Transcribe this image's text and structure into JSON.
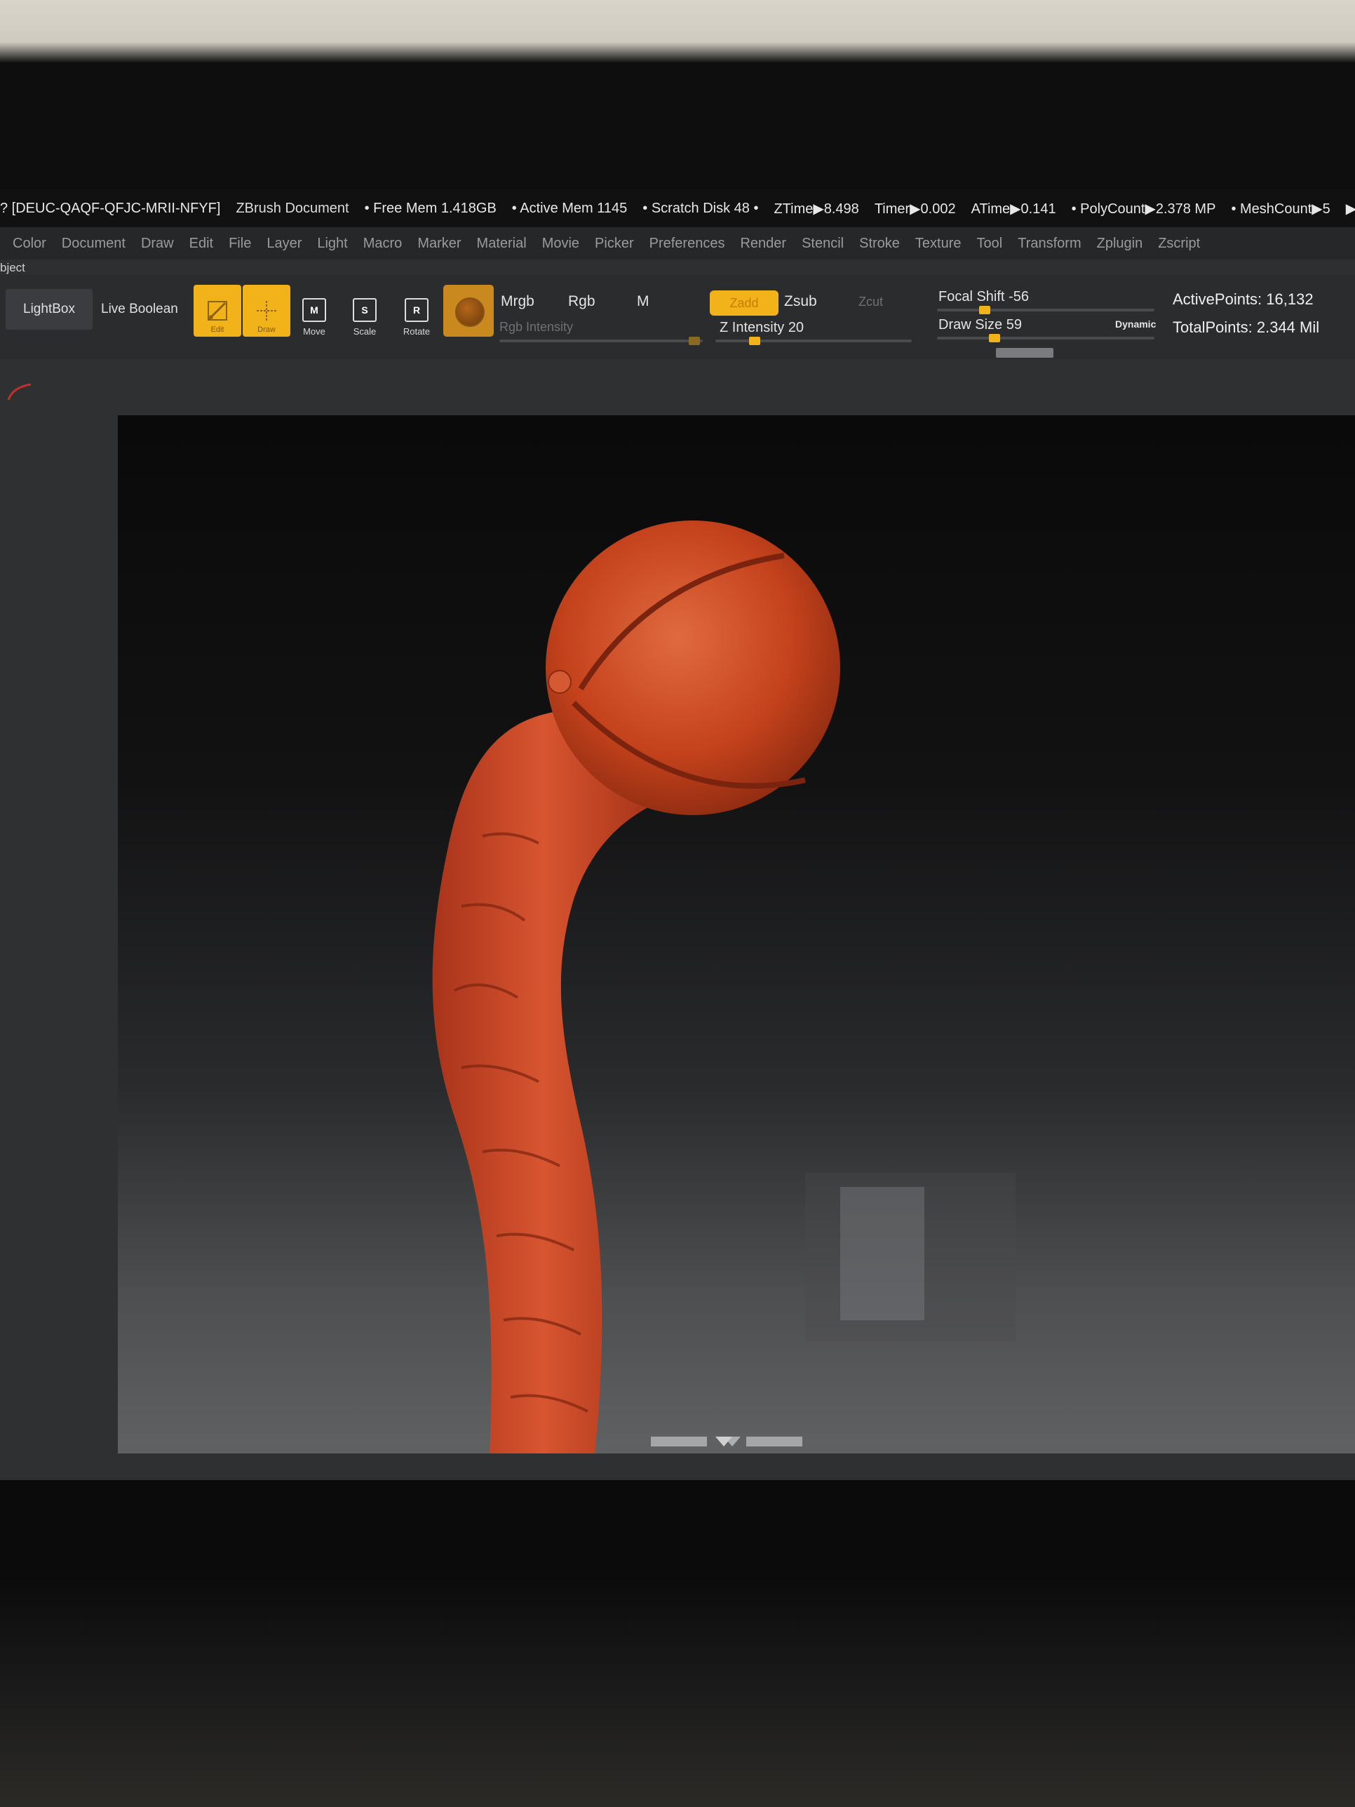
{
  "titlebar": {
    "doc_id": "? [DEUC-QAQF-QFJC-MRII-NFYF]",
    "doc_name": "ZBrush Document",
    "free_mem": "• Free Mem 1.418GB",
    "active_mem": "• Active Mem 1145",
    "scratch": "• Scratch Disk 48 •",
    "ztime": "ZTime▶8.498",
    "timer": "Timer▶0.002",
    "atime": "ATime▶0.141",
    "polycount": "• PolyCount▶2.378 MP",
    "meshcount": "• MeshCount▶5",
    "quicksave": "▶QuickSave In"
  },
  "menu": [
    "Color",
    "Document",
    "Draw",
    "Edit",
    "File",
    "Layer",
    "Light",
    "Macro",
    "Marker",
    "Material",
    "Movie",
    "Picker",
    "Preferences",
    "Render",
    "Stencil",
    "Stroke",
    "Texture",
    "Tool",
    "Transform",
    "Zplugin",
    "Zscript"
  ],
  "object_label": "bject",
  "toolbar": {
    "lightbox": "LightBox",
    "live_boolean": "Live Boolean",
    "edit_label": "Edit",
    "draw_label": "Draw",
    "move_label": "Move",
    "scale_label": "Scale",
    "rotate_label": "Rotate",
    "move_glyph": "M",
    "scale_glyph": "S",
    "rotate_glyph": "R",
    "mrgb": "Mrgb",
    "rgb": "Rgb",
    "m": "M",
    "rgb_intensity": "Rgb Intensity",
    "zadd": "Zadd",
    "zsub": "Zsub",
    "zcut": "Zcut",
    "z_intensity": "Z Intensity 20",
    "focal_shift": "Focal Shift -56",
    "draw_size": "Draw Size 59",
    "dynamic": "Dynamic",
    "active_points": "ActivePoints: 16,132",
    "total_points": "TotalPoints: 2.344 Mil"
  },
  "sliders": {
    "z_intensity_value": 20,
    "focal_shift_value": -56,
    "draw_size_value": 59
  },
  "colors": {
    "accent": "#f2b21a",
    "clay": "#c4421c"
  }
}
